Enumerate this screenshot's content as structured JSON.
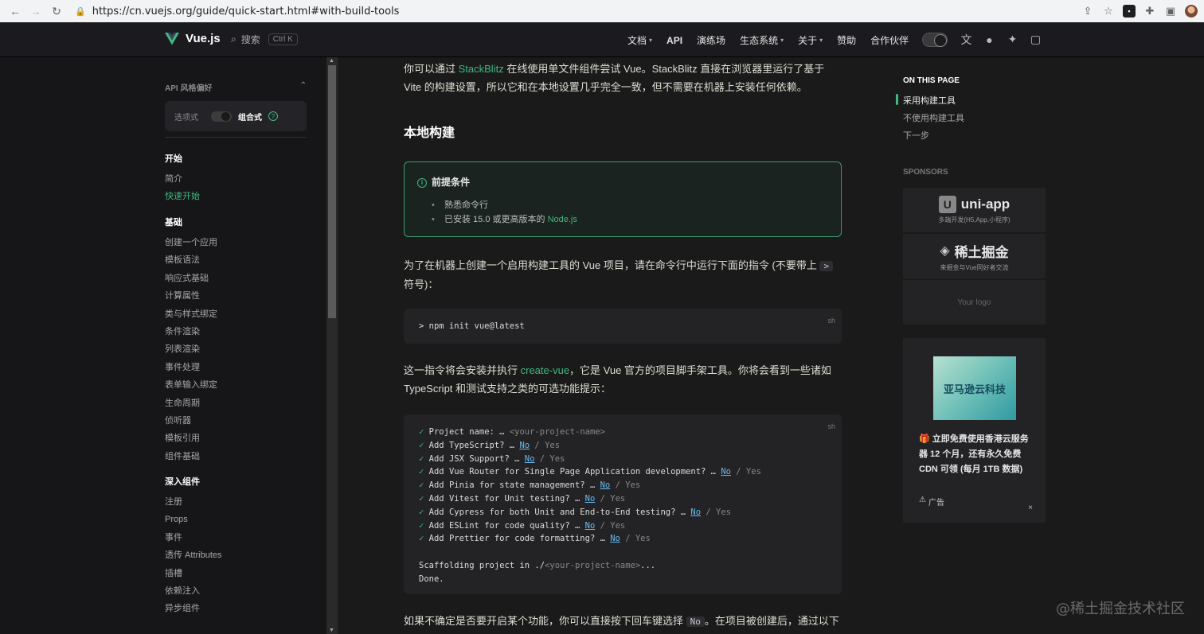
{
  "browser": {
    "url": "https://cn.vuejs.org/guide/quick-start.html#with-build-tools"
  },
  "navbar": {
    "brand": "Vue.js",
    "search_label": "搜索",
    "search_kbd": "Ctrl K",
    "menu": [
      {
        "label": "文档",
        "has_dropdown": true
      },
      {
        "label": "API",
        "has_dropdown": false
      },
      {
        "label": "演练场",
        "has_dropdown": false
      },
      {
        "label": "生态系统",
        "has_dropdown": true
      },
      {
        "label": "关于",
        "has_dropdown": true
      },
      {
        "label": "赞助",
        "has_dropdown": false
      },
      {
        "label": "合作伙伴",
        "has_dropdown": false
      }
    ]
  },
  "sidebar": {
    "api_pref_title": "API 风格偏好",
    "api_pref_option_a": "选项式",
    "api_pref_option_b": "组合式",
    "groups": [
      {
        "title": "开始",
        "links": [
          {
            "label": "简介",
            "active": false
          },
          {
            "label": "快速开始",
            "active": true
          }
        ]
      },
      {
        "title": "基础",
        "links": [
          {
            "label": "创建一个应用",
            "active": false
          },
          {
            "label": "模板语法",
            "active": false
          },
          {
            "label": "响应式基础",
            "active": false
          },
          {
            "label": "计算属性",
            "active": false
          },
          {
            "label": "类与样式绑定",
            "active": false
          },
          {
            "label": "条件渲染",
            "active": false
          },
          {
            "label": "列表渲染",
            "active": false
          },
          {
            "label": "事件处理",
            "active": false
          },
          {
            "label": "表单输入绑定",
            "active": false
          },
          {
            "label": "生命周期",
            "active": false
          },
          {
            "label": "侦听器",
            "active": false
          },
          {
            "label": "模板引用",
            "active": false
          },
          {
            "label": "组件基础",
            "active": false
          }
        ]
      },
      {
        "title": "深入组件",
        "links": [
          {
            "label": "注册",
            "active": false
          },
          {
            "label": "Props",
            "active": false
          },
          {
            "label": "事件",
            "active": false
          },
          {
            "label": "透传 Attributes",
            "active": false
          },
          {
            "label": "插槽",
            "active": false
          },
          {
            "label": "依赖注入",
            "active": false
          },
          {
            "label": "异步组件",
            "active": false
          }
        ]
      }
    ]
  },
  "main": {
    "intro_pre": "你可以通过 ",
    "intro_link": "StackBlitz",
    "intro_post": " 在线使用单文件组件尝试 Vue。StackBlitz 直接在浏览器里运行了基于 Vite 的构建设置，所以它和在本地设置几乎完全一致，但不需要在机器上安装任何依赖。",
    "heading": "本地构建",
    "tip_title": "前提条件",
    "tip_items": [
      "熟悉命令行",
      "已安装 15.0 或更高版本的 "
    ],
    "tip_link": "Node.js",
    "para2_pre": "为了在机器上创建一个启用构建工具的 Vue 项目，请在命令行中运行下面的指令 (不要带上 ",
    "para2_code": ">",
    "para2_post": " 符号)：",
    "code1_lang": "sh",
    "code1_line": "> npm init vue@latest",
    "para3_pre": "这一指令将会安装并执行 ",
    "para3_link": "create-vue",
    "para3_post": "，它是 Vue 官方的项目脚手架工具。你将会看到一些诸如 TypeScript 和测试支持之类的可选功能提示：",
    "code2_lang": "sh",
    "code2_lines": [
      {
        "text": "Project name: … ",
        "placeholder": "<your-project-name>"
      },
      {
        "text": "Add TypeScript? … ",
        "no": "No",
        "yes": " / Yes"
      },
      {
        "text": "Add JSX Support? … ",
        "no": "No",
        "yes": " / Yes"
      },
      {
        "text": "Add Vue Router for Single Page Application development? … ",
        "no": "No",
        "yes": " / Yes"
      },
      {
        "text": "Add Pinia for state management? … ",
        "no": "No",
        "yes": " / Yes"
      },
      {
        "text": "Add Vitest for Unit testing? … ",
        "no": "No",
        "yes": " / Yes"
      },
      {
        "text": "Add Cypress for both Unit and End-to-End testing? … ",
        "no": "No",
        "yes": " / Yes"
      },
      {
        "text": "Add ESLint for code quality? … ",
        "no": "No",
        "yes": " / Yes"
      },
      {
        "text": "Add Prettier for code formatting? … ",
        "no": "No",
        "yes": " / Yes"
      }
    ],
    "code2_scaffold_pre": "Scaffolding project in ./",
    "code2_scaffold_ph": "<your-project-name>",
    "code2_scaffold_post": "...",
    "code2_done": "Done.",
    "para4_pre": "如果不确定是否要开启某个功能，你可以直接按下回车键选择 ",
    "para4_code": "No",
    "para4_post": "。在项目被创建后，通过以下"
  },
  "aside": {
    "on_this_page": "ON THIS PAGE",
    "links": [
      {
        "label": "采用构建工具",
        "active": true
      },
      {
        "label": "不使用构建工具",
        "active": false
      },
      {
        "label": "下一步",
        "active": false
      }
    ],
    "sponsors_title": "SPONSORS",
    "sponsor1_name": "uni-app",
    "sponsor1_sub": "多端开发(H5,App,小程序)",
    "sponsor2_name": "稀土掘金",
    "sponsor2_sub": "来掘金与Vue同好者交流",
    "sponsor3": "Your logo",
    "ad_image_text": "亚马逊云科技",
    "ad_text": "立即免费使用香港云服务器 12 个月，还有永久免费 CDN 可领 (每月 1TB 数据)",
    "ad_label": "广告",
    "ad_close": "×"
  },
  "watermark": "@稀土掘金技术社区",
  "colors": {
    "accent": "#42b883",
    "background": "#1a1a1a"
  }
}
